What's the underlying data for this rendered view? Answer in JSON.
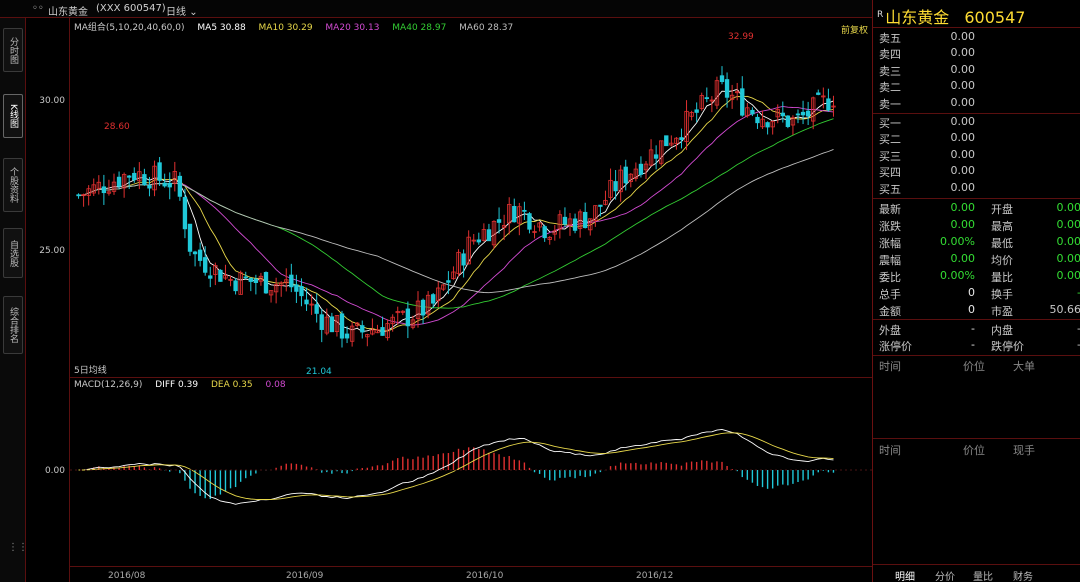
{
  "topbar": {
    "icon": "◦◦",
    "name": "山东黄金",
    "code_info": "(XXX 600547)",
    "period": "日线"
  },
  "left_tabs": [
    "分时图",
    "K线图",
    "个股资料",
    "自选股",
    "综合排名"
  ],
  "price_axis": {
    "labels": [
      "30.00",
      "25.00"
    ]
  },
  "macd_axis": {
    "labels": [
      "0.00"
    ]
  },
  "main_legend": {
    "ma_set": "MA组合(5,10,20,40,60,0)",
    "ma5": "MA5 30.88",
    "ma10": "MA10 30.29",
    "ma20": "MA20 30.13",
    "ma40": "MA40 28.97",
    "ma60": "MA60 28.37"
  },
  "main_annotations": {
    "high_left": "28.60",
    "high_right": "32.99",
    "low": "21.04",
    "corner_tag": "前复权",
    "bottom_tag": "5日均线"
  },
  "macd_legend": {
    "name": "MACD(12,26,9)",
    "diff": "DIFF 0.39",
    "dea": "DEA 0.35",
    "macd": "0.08"
  },
  "date_axis": [
    "2016/08",
    "2016/09",
    "2016/10",
    "2016/12"
  ],
  "right_panel": {
    "title_sup": "R",
    "title": "山东黄金",
    "code": "600547",
    "sell": [
      {
        "label": "卖五",
        "value": "0.00"
      },
      {
        "label": "卖四",
        "value": "0.00"
      },
      {
        "label": "卖三",
        "value": "0.00"
      },
      {
        "label": "卖二",
        "value": "0.00"
      },
      {
        "label": "卖一",
        "value": "0.00"
      }
    ],
    "buy": [
      {
        "label": "买一",
        "value": "0.00"
      },
      {
        "label": "买二",
        "value": "0.00"
      },
      {
        "label": "买三",
        "value": "0.00"
      },
      {
        "label": "买四",
        "value": "0.00"
      },
      {
        "label": "买五",
        "value": "0.00"
      }
    ],
    "stats": [
      {
        "l1": "最新",
        "v1": "0.00",
        "l2": "开盘",
        "v2": "0.00"
      },
      {
        "l1": "涨跌",
        "v1": "0.00",
        "l2": "最高",
        "v2": "0.00"
      },
      {
        "l1": "涨幅",
        "v1": "0.00%",
        "l2": "最低",
        "v2": "0.00"
      },
      {
        "l1": "震幅",
        "v1": "0.00",
        "l2": "均价",
        "v2": "0.00"
      },
      {
        "l1": "委比",
        "v1": "0.00%",
        "l2": "量比",
        "v2": "0.00"
      },
      {
        "l1": "总手",
        "v1": "0",
        "l2": "换手",
        "v2": "-"
      },
      {
        "l1": "金额",
        "v1": "0",
        "l2": "市盈",
        "v2": "50.66"
      }
    ],
    "outer": [
      {
        "l1": "外盘",
        "v1": "-",
        "l2": "内盘",
        "v2": "-"
      },
      {
        "l1": "涨停价",
        "v1": "-",
        "l2": "跌停价",
        "v2": "-"
      }
    ],
    "trade_header1": [
      "时间",
      "价位",
      "大单"
    ],
    "trade_header2": [
      "时间",
      "价位",
      "现手"
    ],
    "bottom_tabs": [
      "明细",
      "分价",
      "量比",
      "财务"
    ]
  },
  "colors": {
    "up": "#e03030",
    "down": "#20c8d8",
    "ma5": "#ffffff",
    "ma10": "#e8d84a",
    "ma20": "#d24bd2",
    "ma40": "#33cc33",
    "ma60": "#bdbdbd",
    "title": "#ffdd33"
  }
}
